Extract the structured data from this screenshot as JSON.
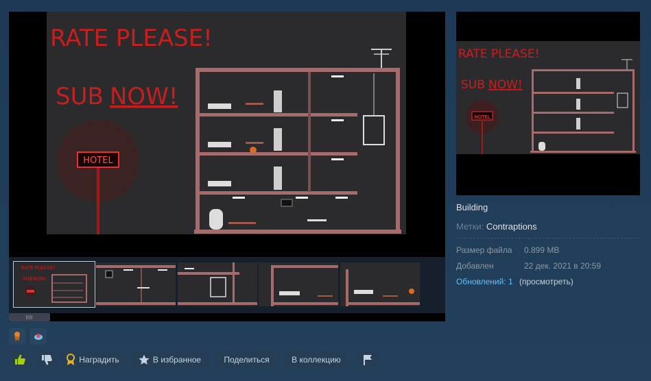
{
  "game_art": {
    "rate_text": "RATE PLEASE!",
    "sub_text_a": "SUB",
    "sub_text_b": "NOW!",
    "hotel_sign": "HOTEL"
  },
  "item": {
    "title": "Building",
    "tags_label": "Метки:",
    "tags_value": "Contraptions"
  },
  "details": {
    "file_size_label": "Размер файла",
    "file_size_value": "0.899 MB",
    "added_label": "Добавлен",
    "added_value": "22 дек. 2021 в 20:59",
    "updates_label": "Обновлений: 1",
    "updates_link": "(просмотреть)"
  },
  "actions": {
    "award": "Наградить",
    "favorite": "В избранное",
    "share": "Поделиться",
    "collection": "В коллекцию"
  },
  "icons": [
    "thumbs-up-icon",
    "thumbs-down-icon",
    "award-icon",
    "star-icon",
    "flag-icon",
    "award-orange-icon",
    "award-blue-icon"
  ],
  "colors": {
    "accent_blue": "#66c0f4",
    "neon_red": "#d8211e",
    "thumbs_up_green": "#a4d007"
  }
}
